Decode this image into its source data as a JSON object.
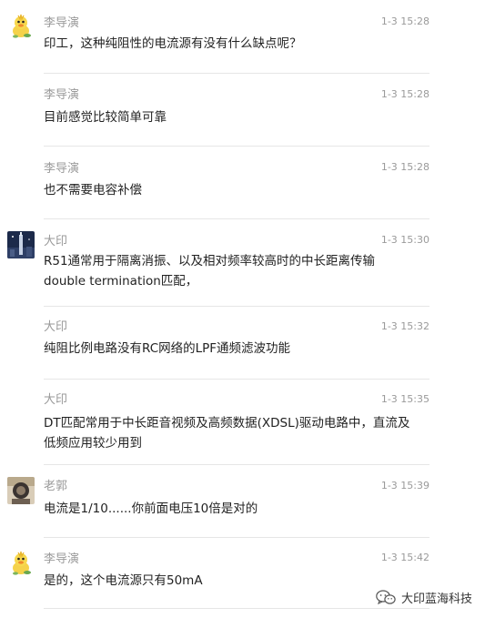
{
  "messages": [
    {
      "sender": "李导演",
      "time": "1-3 15:28",
      "text": "印工，这种纯阻性的电流源有没有什么缺点呢？",
      "avatar": "duck-avatar"
    },
    {
      "sender": "李导演",
      "time": "1-3 15:28",
      "text": "目前感觉比较简单可靠",
      "avatar": ""
    },
    {
      "sender": "李导演",
      "time": "1-3 15:28",
      "text": "也不需要电容补偿",
      "avatar": ""
    },
    {
      "sender": "大印",
      "time": "1-3 15:30",
      "text": "R51通常用于隔离消振、以及相对频率较高时的中长距离传输double termination匹配，",
      "avatar": "night-tower-avatar"
    },
    {
      "sender": "大印",
      "time": "1-3 15:32",
      "text": "纯阻比例电路没有RC网络的LPF通频滤波功能",
      "avatar": ""
    },
    {
      "sender": "大印",
      "time": "1-3 15:35",
      "text": "DT匹配常用于中长距音视频及高频数据(XDSL)驱动电路中，直流及低频应用较少用到",
      "avatar": ""
    },
    {
      "sender": "老郭",
      "time": "1-3 15:39",
      "text": "电流是1/10......你前面电压10倍是对的",
      "avatar": "photo-avatar"
    },
    {
      "sender": "李导演",
      "time": "1-3 15:42",
      "text": "是的，这个电流源只有50mA",
      "avatar": "duck-avatar"
    }
  ],
  "brand": {
    "label": "大印蓝海科技",
    "icon": "wechat-icon"
  }
}
